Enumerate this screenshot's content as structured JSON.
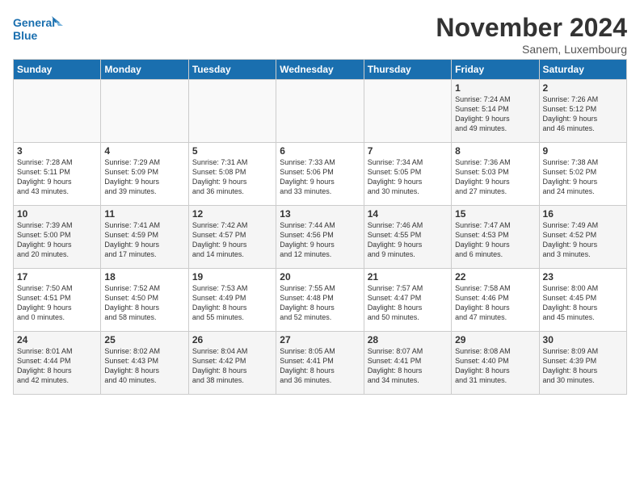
{
  "logo": {
    "line1": "General",
    "line2": "Blue"
  },
  "title": "November 2024",
  "location": "Sanem, Luxembourg",
  "weekdays": [
    "Sunday",
    "Monday",
    "Tuesday",
    "Wednesday",
    "Thursday",
    "Friday",
    "Saturday"
  ],
  "weeks": [
    [
      {
        "day": "",
        "info": ""
      },
      {
        "day": "",
        "info": ""
      },
      {
        "day": "",
        "info": ""
      },
      {
        "day": "",
        "info": ""
      },
      {
        "day": "",
        "info": ""
      },
      {
        "day": "1",
        "info": "Sunrise: 7:24 AM\nSunset: 5:14 PM\nDaylight: 9 hours\nand 49 minutes."
      },
      {
        "day": "2",
        "info": "Sunrise: 7:26 AM\nSunset: 5:12 PM\nDaylight: 9 hours\nand 46 minutes."
      }
    ],
    [
      {
        "day": "3",
        "info": "Sunrise: 7:28 AM\nSunset: 5:11 PM\nDaylight: 9 hours\nand 43 minutes."
      },
      {
        "day": "4",
        "info": "Sunrise: 7:29 AM\nSunset: 5:09 PM\nDaylight: 9 hours\nand 39 minutes."
      },
      {
        "day": "5",
        "info": "Sunrise: 7:31 AM\nSunset: 5:08 PM\nDaylight: 9 hours\nand 36 minutes."
      },
      {
        "day": "6",
        "info": "Sunrise: 7:33 AM\nSunset: 5:06 PM\nDaylight: 9 hours\nand 33 minutes."
      },
      {
        "day": "7",
        "info": "Sunrise: 7:34 AM\nSunset: 5:05 PM\nDaylight: 9 hours\nand 30 minutes."
      },
      {
        "day": "8",
        "info": "Sunrise: 7:36 AM\nSunset: 5:03 PM\nDaylight: 9 hours\nand 27 minutes."
      },
      {
        "day": "9",
        "info": "Sunrise: 7:38 AM\nSunset: 5:02 PM\nDaylight: 9 hours\nand 24 minutes."
      }
    ],
    [
      {
        "day": "10",
        "info": "Sunrise: 7:39 AM\nSunset: 5:00 PM\nDaylight: 9 hours\nand 20 minutes."
      },
      {
        "day": "11",
        "info": "Sunrise: 7:41 AM\nSunset: 4:59 PM\nDaylight: 9 hours\nand 17 minutes."
      },
      {
        "day": "12",
        "info": "Sunrise: 7:42 AM\nSunset: 4:57 PM\nDaylight: 9 hours\nand 14 minutes."
      },
      {
        "day": "13",
        "info": "Sunrise: 7:44 AM\nSunset: 4:56 PM\nDaylight: 9 hours\nand 12 minutes."
      },
      {
        "day": "14",
        "info": "Sunrise: 7:46 AM\nSunset: 4:55 PM\nDaylight: 9 hours\nand 9 minutes."
      },
      {
        "day": "15",
        "info": "Sunrise: 7:47 AM\nSunset: 4:53 PM\nDaylight: 9 hours\nand 6 minutes."
      },
      {
        "day": "16",
        "info": "Sunrise: 7:49 AM\nSunset: 4:52 PM\nDaylight: 9 hours\nand 3 minutes."
      }
    ],
    [
      {
        "day": "17",
        "info": "Sunrise: 7:50 AM\nSunset: 4:51 PM\nDaylight: 9 hours\nand 0 minutes."
      },
      {
        "day": "18",
        "info": "Sunrise: 7:52 AM\nSunset: 4:50 PM\nDaylight: 8 hours\nand 58 minutes."
      },
      {
        "day": "19",
        "info": "Sunrise: 7:53 AM\nSunset: 4:49 PM\nDaylight: 8 hours\nand 55 minutes."
      },
      {
        "day": "20",
        "info": "Sunrise: 7:55 AM\nSunset: 4:48 PM\nDaylight: 8 hours\nand 52 minutes."
      },
      {
        "day": "21",
        "info": "Sunrise: 7:57 AM\nSunset: 4:47 PM\nDaylight: 8 hours\nand 50 minutes."
      },
      {
        "day": "22",
        "info": "Sunrise: 7:58 AM\nSunset: 4:46 PM\nDaylight: 8 hours\nand 47 minutes."
      },
      {
        "day": "23",
        "info": "Sunrise: 8:00 AM\nSunset: 4:45 PM\nDaylight: 8 hours\nand 45 minutes."
      }
    ],
    [
      {
        "day": "24",
        "info": "Sunrise: 8:01 AM\nSunset: 4:44 PM\nDaylight: 8 hours\nand 42 minutes."
      },
      {
        "day": "25",
        "info": "Sunrise: 8:02 AM\nSunset: 4:43 PM\nDaylight: 8 hours\nand 40 minutes."
      },
      {
        "day": "26",
        "info": "Sunrise: 8:04 AM\nSunset: 4:42 PM\nDaylight: 8 hours\nand 38 minutes."
      },
      {
        "day": "27",
        "info": "Sunrise: 8:05 AM\nSunset: 4:41 PM\nDaylight: 8 hours\nand 36 minutes."
      },
      {
        "day": "28",
        "info": "Sunrise: 8:07 AM\nSunset: 4:41 PM\nDaylight: 8 hours\nand 34 minutes."
      },
      {
        "day": "29",
        "info": "Sunrise: 8:08 AM\nSunset: 4:40 PM\nDaylight: 8 hours\nand 31 minutes."
      },
      {
        "day": "30",
        "info": "Sunrise: 8:09 AM\nSunset: 4:39 PM\nDaylight: 8 hours\nand 30 minutes."
      }
    ]
  ]
}
